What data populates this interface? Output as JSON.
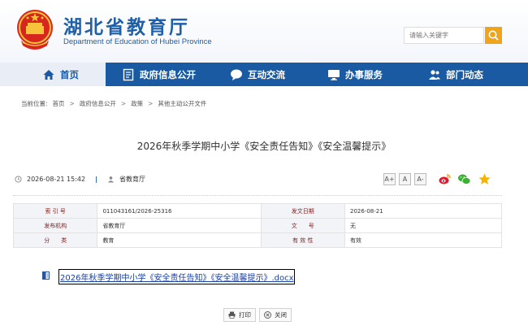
{
  "header": {
    "title": "湖北省教育厅",
    "subtitle": "Department of Education of Hubei Province",
    "search": {
      "placeholder": "请输入关键字"
    }
  },
  "nav": {
    "items": [
      {
        "label": "首页",
        "icon": "home-icon",
        "active": true
      },
      {
        "label": "政府信息公开",
        "icon": "document-icon",
        "active": false
      },
      {
        "label": "互动交流",
        "icon": "chat-bubble-icon",
        "active": false
      },
      {
        "label": "办事服务",
        "icon": "monitor-icon",
        "active": false
      },
      {
        "label": "部门动态",
        "icon": "user-group-icon",
        "active": false
      }
    ]
  },
  "breadcrumb": {
    "prefix": "当前位置:",
    "items": [
      "首页",
      "政府信息公开",
      "政策",
      "其他主动公开文件"
    ]
  },
  "article": {
    "title": "2026年秋季学期中小学《安全责任告知》《安全温馨提示》",
    "date": "2026-08-21 15:42",
    "source": "省教育厅",
    "font_sizes": [
      "A+",
      "A",
      "A-"
    ]
  },
  "info_table": {
    "rows": [
      {
        "label1": "索 引 号",
        "value1": "011043161/2026-25316",
        "label2": "发文日期",
        "value2": "2026-08-21"
      },
      {
        "label1": "发布机构",
        "value1": "省教育厅",
        "label2": "文　　号",
        "value2": "无"
      },
      {
        "label1": "分　　类",
        "value1": "教育",
        "label2": "有 效 性",
        "value2": "有效"
      }
    ]
  },
  "attachment": {
    "filename": "2026年秋季学期中小学《安全责任告知》《安全温馨提示》.docx"
  },
  "buttons": {
    "print": "打印",
    "close": "关闭"
  },
  "colors": {
    "brand_blue": "#1a5aa3",
    "search_orange": "#f0a419",
    "label_red": "#7b1f1f"
  }
}
